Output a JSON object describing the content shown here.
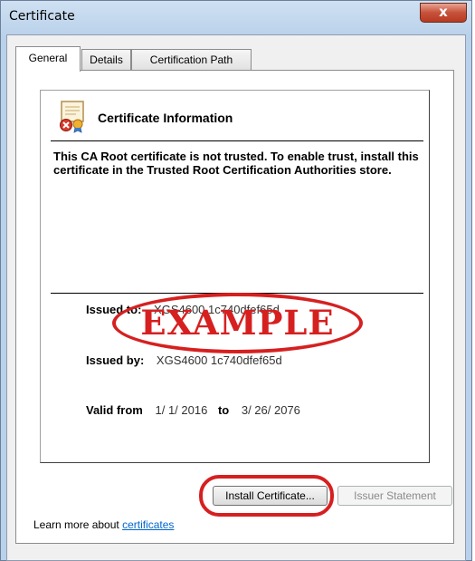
{
  "window": {
    "title": "Certificate",
    "close_label": "x"
  },
  "tabs": [
    {
      "label": "General"
    },
    {
      "label": "Details"
    },
    {
      "label": "Certification Path"
    }
  ],
  "general": {
    "heading": "Certificate Information",
    "description": "This CA Root certificate is not trusted. To enable trust, install this certificate in the Trusted Root Certification Authorities store.",
    "issued_to_label": "Issued to:",
    "issued_to_value": "XGS4600 1c740dfef65d",
    "issued_by_label": "Issued by:",
    "issued_by_value": "XGS4600 1c740dfef65d",
    "valid_from_label": "Valid from",
    "valid_from_value": "1/ 1/ 2016",
    "valid_to_label": "to",
    "valid_to_value": "3/ 26/ 2076",
    "stamp": "EXAMPLE"
  },
  "buttons": {
    "install": "Install Certificate...",
    "issuer_statement": "Issuer Statement"
  },
  "footer": {
    "learn_prefix": "Learn more about ",
    "learn_link": "certificates"
  },
  "colors": {
    "accent_red": "#d62020",
    "link": "#0066cc"
  }
}
